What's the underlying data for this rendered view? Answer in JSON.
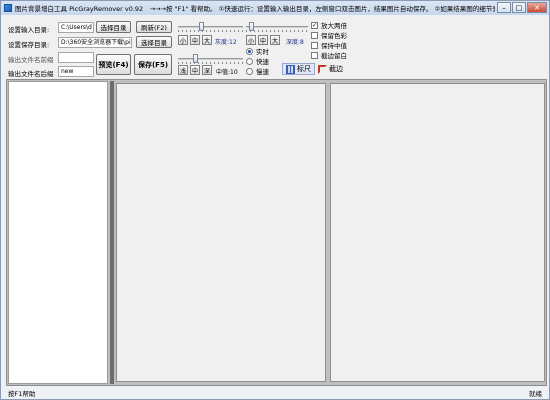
{
  "window": {
    "title": "图片背景增白工具 PicGrayRemover v0.92　→→→按 \"F1\" 看帮助。 ①快速运行：设置输入输出目录，左侧窗口双击图片，结果图片自动保存。 ②如果结果图的细节丢失，请..."
  },
  "form": {
    "input_dir_label": "设置输入目录:",
    "input_dir_value": "C:\\Users\\d",
    "select_dir_btn": "选择目录",
    "refresh_btn": "刷新(F2)",
    "save_dir_label": "设置保存目录:",
    "save_dir_value": "D:\\360安全浏览器下载\\pi",
    "select_dir_btn2": "选择目录",
    "prefix_label": "输出文件名前缀",
    "prefix_value": "",
    "suffix_label": "输出文件名后缀",
    "suffix_value": "new",
    "preview_btn": "预览(F4)",
    "save_btn": "保存(F5)"
  },
  "controls": {
    "small": "小",
    "mid": "中",
    "big": "大",
    "light": "浅",
    "dark": "深",
    "brightness_label": "灰度:12",
    "depth_label": "深度:8",
    "median_label": "中值:10",
    "brightness_level": 0.35,
    "depth_level": 0.05,
    "median_level": 0.25
  },
  "modes": {
    "realtime": "实时",
    "fast": "快速",
    "slow": "慢速",
    "selected": "realtime"
  },
  "options": [
    {
      "label": "放大两倍",
      "checked": true
    },
    {
      "label": "保留色彩",
      "checked": false
    },
    {
      "label": "保持中值",
      "checked": false
    },
    {
      "label": "截边留白",
      "checked": false
    }
  ],
  "tools": {
    "ruler": "标尺",
    "crop": "截边"
  },
  "status": {
    "left": "按F1帮助",
    "right": "就绪"
  }
}
